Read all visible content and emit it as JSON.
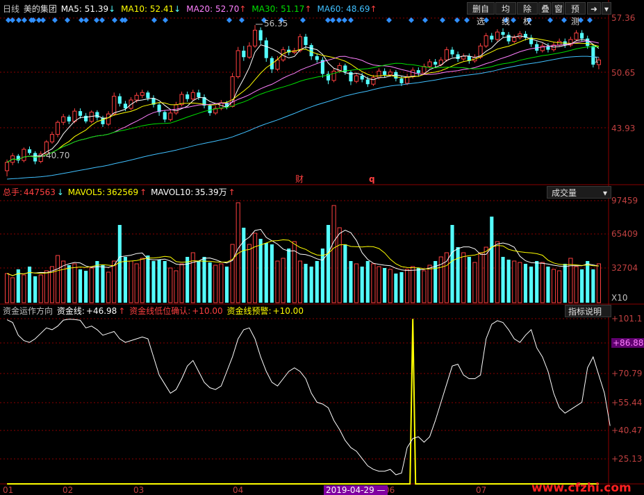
{
  "colors": {
    "up": "#ff4040",
    "down": "#54ffff",
    "grid": "#8b0000",
    "ma5": "#ffffff",
    "ma10": "#ffff00",
    "ma20": "#ff80ff",
    "ma30": "#00e000",
    "ma60": "#40c0ff",
    "fund_line": "#ffffff",
    "low_confirm": "#ff4040",
    "warning": "#ffff00"
  },
  "price_panel": {
    "period": "日线",
    "stock_name": "美的集团",
    "ma": [
      {
        "label": "MA5:",
        "value": "51.39",
        "arrow": "↓",
        "color": "#ffffff"
      },
      {
        "label": "MA10:",
        "value": "52.41",
        "arrow": "↓",
        "color": "#ffff00"
      },
      {
        "label": "MA20:",
        "value": "52.70",
        "arrow": "↑",
        "color": "#ff80ff"
      },
      {
        "label": "MA30:",
        "value": "51.17",
        "arrow": "↑",
        "color": "#00e000"
      },
      {
        "label": "MA60:",
        "value": "48.69",
        "arrow": "↑",
        "color": "#40c0ff"
      }
    ],
    "toolbar": [
      "删自选",
      "均线",
      "除权",
      "叠",
      "窗",
      "预测"
    ],
    "ticks": [
      "57.36",
      "50.65",
      "43.93"
    ],
    "high_marker": "56.35",
    "low_marker": "40.70",
    "marker_cai": "财",
    "marker_q": "q",
    "last_marker": "1"
  },
  "volume_panel": {
    "title": "总手:",
    "total": "447563",
    "total_arrow": "↓",
    "mavol5_label": "MAVOL5:",
    "mavol5": "362569",
    "mavol5_arrow": "↑",
    "mavol10_label": "MAVOL10:",
    "mavol10": "35.39万",
    "mavol10_arrow": "↑",
    "selector": "成交量",
    "ticks": [
      "97459",
      "65409",
      "32704"
    ],
    "unit": "X10"
  },
  "indicator_panel": {
    "title": "资金运作方向",
    "fund_label": "资金线:",
    "fund_value": "+46.98",
    "fund_arrow": "↑",
    "low_label": "资金线低位确认:",
    "low_value": "+10.00",
    "warn_label": "资金线预警:",
    "warn_value": "+10.00",
    "explain_button": "指标说明",
    "ticks": [
      "+101.1",
      "+86.88",
      "+70.79",
      "+55.44",
      "+40.47",
      "+25.13"
    ],
    "current_value_tag": "+86.88"
  },
  "x_axis": {
    "months": [
      "01",
      "02",
      "03",
      "04",
      "06",
      "07"
    ],
    "cursor_date": "2019-04-29 —"
  },
  "watermark": "www.cfzhi.com",
  "chart_data": {
    "type": "candlestick",
    "candles": [
      [
        40.7,
        41.6,
        40.1,
        41.9
      ],
      [
        41.6,
        42.3,
        41.3,
        42.6
      ],
      [
        42.3,
        41.8,
        41.5,
        42.5
      ],
      [
        41.8,
        43.0,
        41.6,
        43.2
      ],
      [
        43.0,
        42.6,
        42.4,
        43.3
      ],
      [
        42.6,
        41.7,
        41.4,
        42.8
      ],
      [
        41.7,
        42.5,
        41.5,
        42.8
      ],
      [
        42.5,
        43.8,
        42.3,
        44.0
      ],
      [
        43.8,
        44.6,
        43.6,
        44.9
      ],
      [
        44.6,
        45.9,
        44.3,
        46.1
      ],
      [
        45.9,
        46.5,
        45.6,
        46.8
      ],
      [
        46.5,
        46.0,
        45.7,
        46.7
      ],
      [
        46.0,
        47.1,
        45.8,
        47.4
      ],
      [
        47.1,
        46.6,
        46.3,
        47.4
      ],
      [
        46.6,
        46.0,
        45.8,
        46.9
      ],
      [
        46.0,
        47.0,
        45.8,
        47.2
      ],
      [
        47.0,
        46.4,
        46.1,
        47.2
      ],
      [
        46.4,
        45.7,
        45.4,
        46.6
      ],
      [
        45.7,
        46.8,
        45.5,
        47.1
      ],
      [
        46.8,
        48.7,
        46.6,
        49.1
      ],
      [
        48.7,
        47.9,
        47.6,
        49.0
      ],
      [
        47.9,
        47.4,
        47.1,
        48.2
      ],
      [
        47.4,
        48.3,
        47.2,
        48.6
      ],
      [
        48.3,
        48.8,
        48.0,
        49.1
      ],
      [
        48.8,
        49.1,
        48.5,
        49.4
      ],
      [
        49.1,
        48.5,
        48.2,
        49.3
      ],
      [
        48.5,
        47.8,
        47.5,
        48.8
      ],
      [
        47.8,
        47.0,
        46.6,
        48.0
      ],
      [
        47.0,
        46.2,
        45.9,
        47.2
      ],
      [
        46.2,
        46.9,
        46.0,
        47.2
      ],
      [
        46.9,
        47.8,
        46.7,
        48.1
      ],
      [
        47.8,
        48.9,
        47.6,
        49.2
      ],
      [
        48.9,
        48.4,
        48.1,
        49.2
      ],
      [
        48.4,
        49.1,
        48.2,
        49.4
      ],
      [
        49.1,
        48.6,
        48.3,
        49.4
      ],
      [
        48.6,
        47.7,
        47.4,
        48.9
      ],
      [
        47.7,
        46.9,
        46.6,
        47.9
      ],
      [
        46.9,
        47.4,
        46.7,
        47.7
      ],
      [
        47.4,
        48.0,
        47.2,
        48.3
      ],
      [
        48.0,
        47.6,
        47.3,
        48.2
      ],
      [
        47.6,
        50.8,
        47.5,
        51.2
      ],
      [
        50.8,
        53.6,
        50.6,
        54.0
      ],
      [
        53.6,
        52.9,
        52.5,
        54.1
      ],
      [
        52.9,
        54.1,
        52.7,
        54.5
      ],
      [
        54.1,
        55.8,
        53.9,
        56.35
      ],
      [
        55.8,
        54.7,
        54.3,
        56.1
      ],
      [
        54.7,
        52.8,
        52.4,
        55.0
      ],
      [
        52.8,
        51.6,
        51.2,
        53.0
      ],
      [
        51.6,
        52.6,
        51.4,
        53.0
      ],
      [
        52.6,
        53.7,
        52.4,
        54.0
      ],
      [
        53.7,
        53.4,
        53.1,
        54.1
      ],
      [
        53.4,
        53.6,
        53.2,
        53.9
      ],
      [
        53.6,
        55.1,
        53.4,
        55.4
      ],
      [
        55.1,
        54.2,
        53.8,
        55.4
      ],
      [
        54.2,
        53.0,
        52.6,
        54.4
      ],
      [
        53.0,
        52.6,
        52.3,
        53.3
      ],
      [
        52.6,
        51.1,
        50.7,
        52.9
      ],
      [
        51.1,
        50.4,
        50.0,
        51.4
      ],
      [
        50.4,
        51.4,
        50.2,
        51.7
      ],
      [
        51.4,
        52.0,
        51.2,
        52.3
      ],
      [
        52.0,
        51.3,
        51.0,
        52.2
      ],
      [
        51.3,
        50.3,
        49.9,
        51.5
      ],
      [
        50.3,
        50.9,
        50.1,
        51.2
      ],
      [
        50.9,
        50.5,
        50.2,
        51.2
      ],
      [
        50.5,
        50.0,
        49.7,
        50.8
      ],
      [
        50.0,
        50.7,
        49.8,
        51.0
      ],
      [
        50.7,
        51.4,
        50.5,
        51.7
      ],
      [
        51.4,
        51.0,
        50.7,
        51.7
      ],
      [
        51.0,
        51.3,
        50.8,
        51.6
      ],
      [
        51.3,
        50.6,
        50.3,
        51.5
      ],
      [
        50.6,
        50.1,
        49.8,
        50.9
      ],
      [
        50.1,
        50.8,
        49.9,
        51.1
      ],
      [
        50.8,
        51.5,
        50.6,
        51.8
      ],
      [
        51.5,
        51.2,
        50.9,
        51.8
      ],
      [
        51.2,
        51.9,
        51.0,
        52.2
      ],
      [
        51.9,
        52.4,
        51.7,
        52.7
      ],
      [
        52.4,
        52.1,
        51.8,
        52.7
      ],
      [
        52.1,
        52.6,
        51.9,
        52.9
      ],
      [
        52.6,
        53.7,
        52.4,
        54.0
      ],
      [
        53.7,
        53.2,
        52.9,
        54.0
      ],
      [
        53.2,
        52.7,
        52.4,
        53.5
      ],
      [
        52.7,
        53.0,
        52.5,
        53.3
      ],
      [
        53.0,
        52.5,
        52.2,
        53.3
      ],
      [
        52.5,
        52.9,
        52.3,
        53.2
      ],
      [
        52.9,
        54.1,
        52.7,
        54.4
      ],
      [
        54.1,
        55.2,
        53.9,
        55.5
      ],
      [
        55.2,
        54.8,
        54.5,
        55.5
      ],
      [
        54.8,
        55.6,
        54.6,
        55.9
      ],
      [
        55.6,
        55.3,
        55.0,
        56.0
      ],
      [
        55.3,
        54.6,
        54.3,
        55.6
      ],
      [
        54.6,
        55.0,
        54.4,
        55.3
      ],
      [
        55.0,
        55.4,
        54.8,
        55.7
      ],
      [
        55.4,
        55.0,
        54.7,
        55.7
      ],
      [
        55.0,
        54.3,
        54.0,
        55.3
      ],
      [
        54.3,
        53.6,
        53.3,
        54.6
      ],
      [
        53.6,
        54.1,
        53.4,
        54.4
      ],
      [
        54.1,
        53.7,
        53.4,
        54.4
      ],
      [
        53.7,
        54.2,
        53.5,
        54.5
      ],
      [
        54.2,
        54.6,
        54.0,
        54.9
      ],
      [
        54.6,
        54.2,
        53.9,
        54.9
      ],
      [
        54.2,
        54.8,
        54.0,
        55.1
      ],
      [
        54.8,
        55.5,
        54.6,
        55.8
      ],
      [
        55.5,
        54.9,
        54.6,
        55.8
      ],
      [
        54.9,
        54.1,
        53.8,
        55.2
      ],
      [
        54.1,
        52.1,
        51.8,
        54.3
      ],
      [
        52.1,
        52.6,
        51.6,
        52.9
      ]
    ],
    "volume": [
      210,
      180,
      240,
      200,
      260,
      190,
      200,
      230,
      260,
      340,
      300,
      270,
      280,
      240,
      230,
      250,
      300,
      270,
      220,
      300,
      560,
      330,
      300,
      280,
      320,
      340,
      300,
      310,
      300,
      250,
      230,
      280,
      330,
      360,
      300,
      330,
      290,
      270,
      280,
      260,
      420,
      720,
      540,
      420,
      500,
      460,
      430,
      420,
      300,
      320,
      390,
      440,
      300,
      280,
      260,
      300,
      390,
      560,
      700,
      540,
      420,
      300,
      280,
      260,
      300,
      280,
      260,
      250,
      240,
      210,
      220,
      240,
      260,
      250,
      230,
      270,
      300,
      330,
      360,
      560,
      400,
      360,
      330,
      290,
      360,
      400,
      620,
      440,
      330,
      310,
      300,
      290,
      280,
      260,
      300,
      290,
      260,
      240,
      230,
      280,
      320,
      260,
      240,
      300,
      240,
      280
    ],
    "fund_line": [
      100.5,
      99,
      92,
      89,
      88,
      90,
      93,
      96,
      95,
      97,
      100.3,
      100.8,
      100.6,
      100.2,
      96,
      97,
      95,
      92,
      93,
      94,
      90,
      88,
      89,
      90,
      91,
      90,
      80,
      70,
      65,
      60,
      62,
      68,
      75,
      78,
      72,
      66,
      63,
      62,
      64,
      72,
      80,
      90,
      95,
      96,
      90,
      80,
      72,
      66,
      64,
      68,
      72,
      74,
      72,
      68,
      60,
      55,
      54,
      52,
      45,
      40,
      34,
      30,
      28,
      24,
      20,
      18,
      17,
      17,
      18,
      15,
      16,
      30,
      35,
      36,
      33,
      36,
      45,
      55,
      65,
      75,
      76,
      70,
      68,
      68,
      70,
      90,
      98,
      100,
      99,
      95,
      90,
      88,
      92,
      95,
      85,
      80,
      72,
      60,
      52,
      49,
      51,
      53,
      55,
      74,
      80,
      70,
      60,
      42
    ],
    "warning_spike_index": 72,
    "ylim_price": [
      39.5,
      57.4
    ],
    "ylim_volume": [
      0,
      97459
    ],
    "ylim_indicator": [
      10,
      101.1
    ]
  }
}
